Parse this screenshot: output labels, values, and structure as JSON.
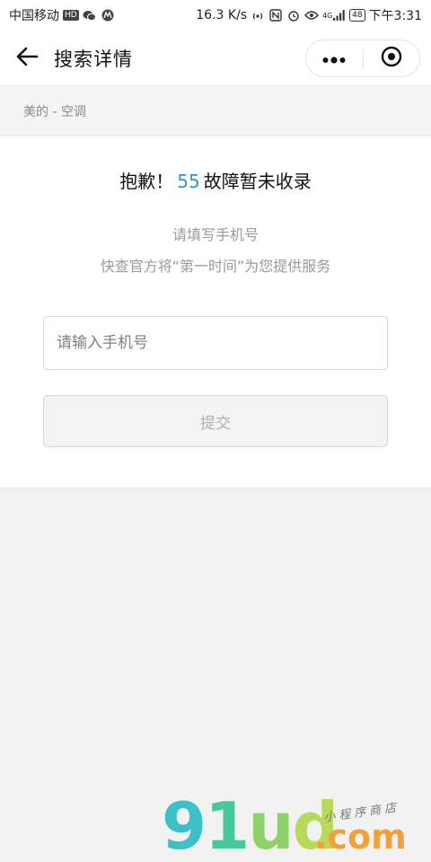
{
  "status_bar": {
    "carrier": "中国移动",
    "hd_badge": "HD",
    "speed": "16.3 K/s",
    "network": "4G",
    "battery": "48",
    "time": "下午3:31"
  },
  "header": {
    "title": "搜索详情"
  },
  "breadcrumb": {
    "text": "美的 - 空调"
  },
  "main": {
    "headline_prefix": "抱歉！",
    "fault_code": "55",
    "headline_suffix": "故障暂未收录",
    "hint_line1": "请填写手机号",
    "hint_line2": "快查官方将“第一时间”为您提供服务",
    "phone_input": {
      "value": "",
      "placeholder": "请输入手机号"
    },
    "submit_label": "提交"
  },
  "watermark": {
    "logo": "91ud",
    "domain": ".com",
    "tagline": "小程序商店"
  },
  "colors": {
    "fault_code": "#3b8fc4",
    "background": "#f2f2f2",
    "card": "#ffffff"
  },
  "icons": {
    "back": "arrow-left-icon",
    "more": "more-dots-icon",
    "close": "target-circle-icon"
  }
}
